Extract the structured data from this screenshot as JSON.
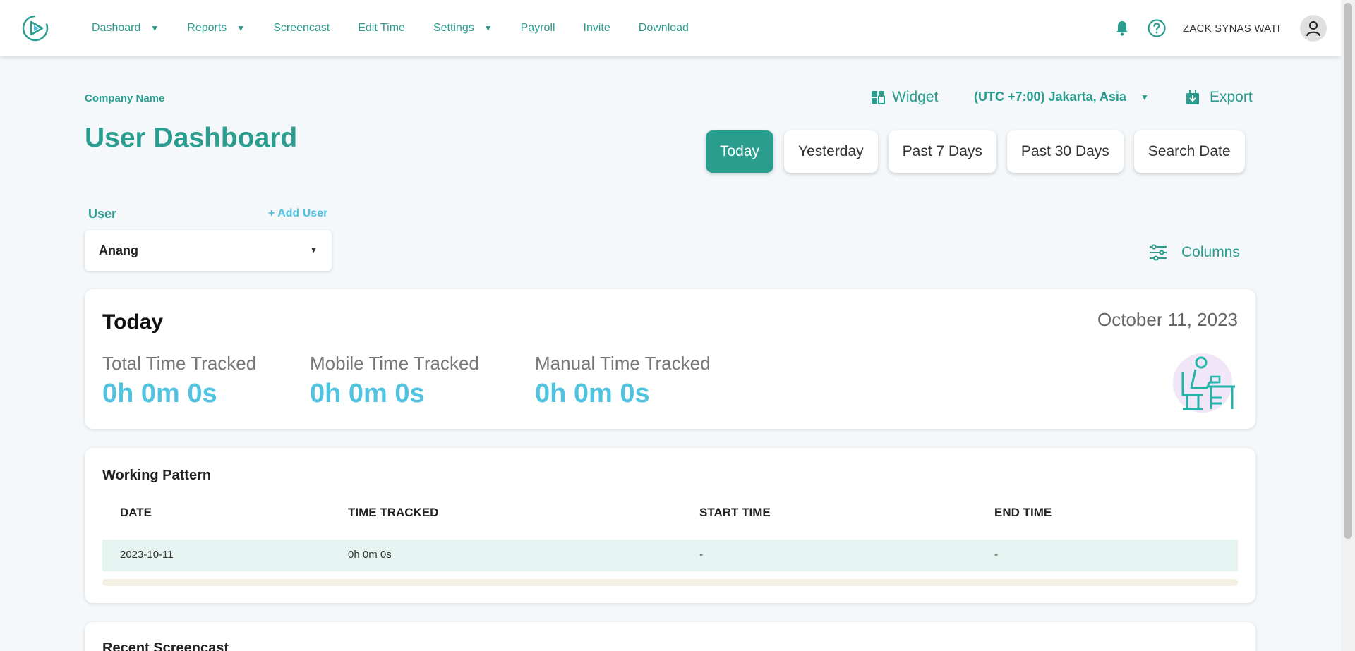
{
  "nav": {
    "items": [
      {
        "label": "Dashoard",
        "dropdown": true
      },
      {
        "label": "Reports",
        "dropdown": true
      },
      {
        "label": "Screencast",
        "dropdown": false
      },
      {
        "label": "Edit Time",
        "dropdown": false
      },
      {
        "label": "Settings",
        "dropdown": true
      },
      {
        "label": "Payroll",
        "dropdown": false
      },
      {
        "label": "Invite",
        "dropdown": false
      },
      {
        "label": "Download",
        "dropdown": false
      }
    ],
    "caret": "▼",
    "user_name": "ZACK SYNAS WATI"
  },
  "header": {
    "company": "Company Name",
    "title": "User Dashboard",
    "widget_label": "Widget",
    "timezone": "(UTC +7:00) Jakarta, Asia",
    "export_label": "Export"
  },
  "range_buttons": [
    "Today",
    "Yesterday",
    "Past 7 Days",
    "Past 30 Days",
    "Search Date"
  ],
  "active_range": "Today",
  "user_filter": {
    "label": "User",
    "add_label": "+ Add User",
    "selected": "Anang"
  },
  "columns_label": "Columns",
  "today_card": {
    "title": "Today",
    "date": "October 11, 2023",
    "stats": [
      {
        "label": "Total Time Tracked",
        "value": "0h 0m 0s"
      },
      {
        "label": "Mobile Time Tracked",
        "value": "0h 0m 0s"
      },
      {
        "label": "Manual Time Tracked",
        "value": "0h 0m 0s"
      }
    ]
  },
  "working_pattern": {
    "title": "Working Pattern",
    "headers": [
      "DATE",
      "TIME TRACKED",
      "START TIME",
      "END TIME"
    ],
    "rows": [
      [
        "2023-10-11",
        "0h 0m 0s",
        "-",
        "-"
      ]
    ]
  },
  "recent_screencast": {
    "title": "Recent Screencast"
  },
  "colors": {
    "primary": "#2a9d8f",
    "accent": "#4fc3e0",
    "row_highlight": "#e6f4f1"
  }
}
